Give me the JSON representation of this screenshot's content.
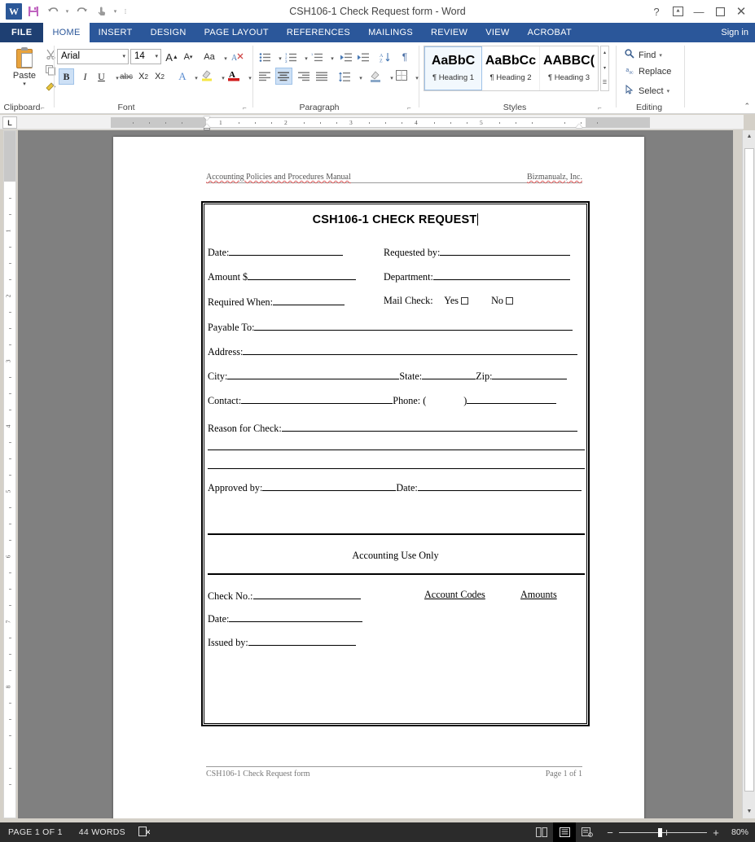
{
  "window": {
    "title": "CSH106-1 Check Request form - Word",
    "quick_access": [
      {
        "name": "word-logo",
        "glyph": "W"
      },
      {
        "name": "save-icon",
        "glyph": "ὋE"
      },
      {
        "name": "undo-icon",
        "glyph": "↶"
      },
      {
        "name": "undo-arrow",
        "glyph": "▾"
      },
      {
        "name": "redo-icon",
        "glyph": "↻"
      },
      {
        "name": "touch-mode-icon",
        "glyph": "☝"
      },
      {
        "name": "touch-arrow",
        "glyph": "▾"
      },
      {
        "name": "customize-qat-icon",
        "glyph": "≡"
      }
    ],
    "controls": {
      "help": "?",
      "ribbon_display": "⬚",
      "minimize": "—",
      "maximize": "☐",
      "close": "✕"
    },
    "sign_in": "Sign in"
  },
  "ribbon": {
    "tabs": [
      {
        "label": "FILE",
        "active": false,
        "file": true
      },
      {
        "label": "HOME",
        "active": true
      },
      {
        "label": "INSERT",
        "active": false
      },
      {
        "label": "DESIGN",
        "active": false
      },
      {
        "label": "PAGE LAYOUT",
        "active": false
      },
      {
        "label": "REFERENCES",
        "active": false
      },
      {
        "label": "MAILINGS",
        "active": false
      },
      {
        "label": "REVIEW",
        "active": false
      },
      {
        "label": "VIEW",
        "active": false
      },
      {
        "label": "ACROBAT",
        "active": false
      }
    ],
    "groups": {
      "clipboard": {
        "label": "Clipboard",
        "paste_label": "Paste",
        "paste_arrow": "▾",
        "cut_icon": "✂",
        "copy_icon": "⧉",
        "format_painter_icon": "✎"
      },
      "font": {
        "label": "Font",
        "font_name": "Arial",
        "font_size": "14",
        "grow_font": "A",
        "shrink_font": "A",
        "change_case": "Aa",
        "clear_formatting": "A",
        "bold": "B",
        "italic": "I",
        "underline": "U",
        "strikethrough": "abc",
        "subscript": "X₂",
        "superscript": "X²",
        "text_effects": "A",
        "highlight": "ab",
        "font_color": "A",
        "arrow": "▾"
      },
      "paragraph": {
        "label": "Paragraph",
        "bullets": "≡",
        "numbering": "≡",
        "multilevel": "≡",
        "decrease_indent": "⬅",
        "increase_indent": "➡",
        "sort": "A↓",
        "show_marks": "¶",
        "align_left": "≡",
        "align_center": "≡",
        "align_right": "≡",
        "justify": "≡",
        "line_spacing": "≡",
        "shading": "▤",
        "borders": "⊞",
        "arrow": "▾",
        "active_button": "align_center"
      },
      "styles": {
        "label": "Styles",
        "items": [
          {
            "preview": "AaBbC",
            "name": "¶ Heading 1",
            "selected": true
          },
          {
            "preview": "AaBbCc",
            "name": "¶ Heading 2",
            "selected": false
          },
          {
            "preview": "AABBC(",
            "name": "¶ Heading 3",
            "selected": false
          }
        ],
        "scroll_up": "▴",
        "scroll_down": "▾",
        "more": "▾"
      },
      "editing": {
        "label": "Editing",
        "items": [
          {
            "label": "Find",
            "icon": "🔍",
            "arrow": "▾"
          },
          {
            "label": "Replace",
            "icon": "ab"
          },
          {
            "label": "Select",
            "icon": "↖",
            "arrow": "▾"
          }
        ]
      }
    },
    "collapse": "⌃"
  },
  "ruler": {
    "corner_label": "L",
    "horizontal_numbers": [
      "1",
      "2",
      "3",
      "4",
      "5"
    ],
    "vertical_numbers": [
      "1",
      "2",
      "3",
      "4",
      "5",
      "6",
      "7",
      "8"
    ]
  },
  "document": {
    "header": {
      "left": "Accounting Policies and Procedures Manual",
      "right": "Bizmanualz, Inc."
    },
    "form": {
      "title": "CSH106-1 CHECK REQUEST",
      "fields_left": [
        {
          "label": "Date:",
          "line_width": 140
        },
        {
          "label": "Amount $",
          "line_width": 133
        },
        {
          "label": "Required When:",
          "line_width": 88
        }
      ],
      "fields_right": [
        {
          "label": "Requested by:",
          "line_width": 160
        },
        {
          "label": "Department:",
          "line_width": 168
        }
      ],
      "mail_check": {
        "label": "Mail Check:",
        "yes_label": "Yes",
        "no_label": "No"
      },
      "fields_full": [
        {
          "label": "Payable To:",
          "line_width": 391
        },
        {
          "label": "Address:",
          "line_width": 411
        }
      ],
      "city_row": [
        {
          "label": "City:",
          "line_width": 211
        },
        {
          "label": "State:",
          "line_width": 66
        },
        {
          "label": "Zip:",
          "line_width": 92
        }
      ],
      "contact_row": [
        {
          "label": "Contact:",
          "line_width": 186
        },
        {
          "label": "Phone: (",
          "line_width": 46,
          "suffix": ")",
          "line2_width": 110
        }
      ],
      "reason": {
        "label": "Reason for Check:",
        "line_width": 363,
        "extra_lines": 2
      },
      "approval_row": [
        {
          "label": "Approved by:",
          "line_width": 164
        },
        {
          "label": "Date:",
          "line_width": 201
        }
      ],
      "accounting_section": {
        "title": "Accounting Use Only",
        "fields": [
          {
            "label": "Check No.:",
            "line_width": 132
          },
          {
            "label": "Date:",
            "line_width": 164
          },
          {
            "label": "Issued by:",
            "line_width": 132
          }
        ],
        "columns": [
          "Account Codes",
          "Amounts"
        ]
      }
    },
    "footer": {
      "left": "CSH106-1 Check Request form",
      "right": "Page 1 of 1"
    }
  },
  "status_bar": {
    "page_info": "PAGE 1 OF 1",
    "word_count": "44 WORDS",
    "proofing_icon": "⌸",
    "views": [
      {
        "name": "read-mode",
        "glyph": "▥",
        "active": false
      },
      {
        "name": "print-layout",
        "glyph": "▤",
        "active": true
      },
      {
        "name": "web-layout",
        "glyph": "▧",
        "active": false
      }
    ],
    "zoom_out": "−",
    "zoom_in": "+",
    "zoom_level": "80%"
  }
}
